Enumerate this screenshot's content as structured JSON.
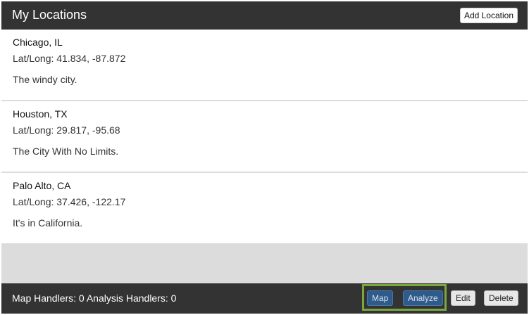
{
  "header": {
    "title": "My Locations",
    "add_button": "Add Location"
  },
  "locations": [
    {
      "name": "Chicago, IL",
      "coords": "Lat/Long: 41.834, -87.872",
      "description": "The windy city."
    },
    {
      "name": "Houston, TX",
      "coords": "Lat/Long: 29.817, -95.68",
      "description": "The City With No Limits."
    },
    {
      "name": "Palo Alto, CA",
      "coords": "Lat/Long: 37.426, -122.17",
      "description": "It's in California."
    }
  ],
  "footer": {
    "status": "Map Handlers: 0 Analysis Handlers: 0",
    "map_button": "Map",
    "analyze_button": "Analyze",
    "edit_button": "Edit",
    "delete_button": "Delete"
  },
  "colors": {
    "header_bg": "#333333",
    "highlight_border": "#7aa83f",
    "primary_button": "#2f5b8a"
  }
}
